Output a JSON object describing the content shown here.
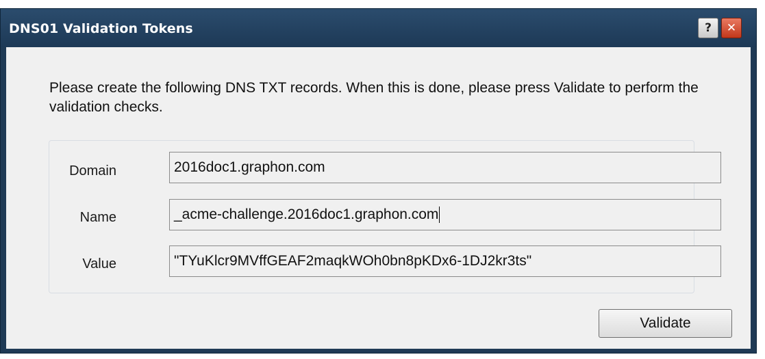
{
  "window": {
    "title": "DNS01 Validation Tokens",
    "help_glyph": "?",
    "close_glyph": "✕"
  },
  "message": "Please create the following DNS TXT records. When this is done, please press Validate to perform the validation checks.",
  "fields": {
    "domain": {
      "label": "Domain",
      "value": "2016doc1.graphon.com"
    },
    "name": {
      "label": "Name",
      "value": "_acme-challenge.2016doc1.graphon.com"
    },
    "value": {
      "label": "Value",
      "value": "\"TYuKlcr9MVffGEAF2maqkWOh0bn8pKDx6-1DJ2kr3ts\""
    }
  },
  "buttons": {
    "validate_label": "Validate"
  },
  "icons": {
    "help": "help-icon",
    "close": "close-icon"
  },
  "colors": {
    "titlebar": "#1f3a55",
    "close_button": "#c2371a",
    "client_background": "#f0f0f0"
  }
}
